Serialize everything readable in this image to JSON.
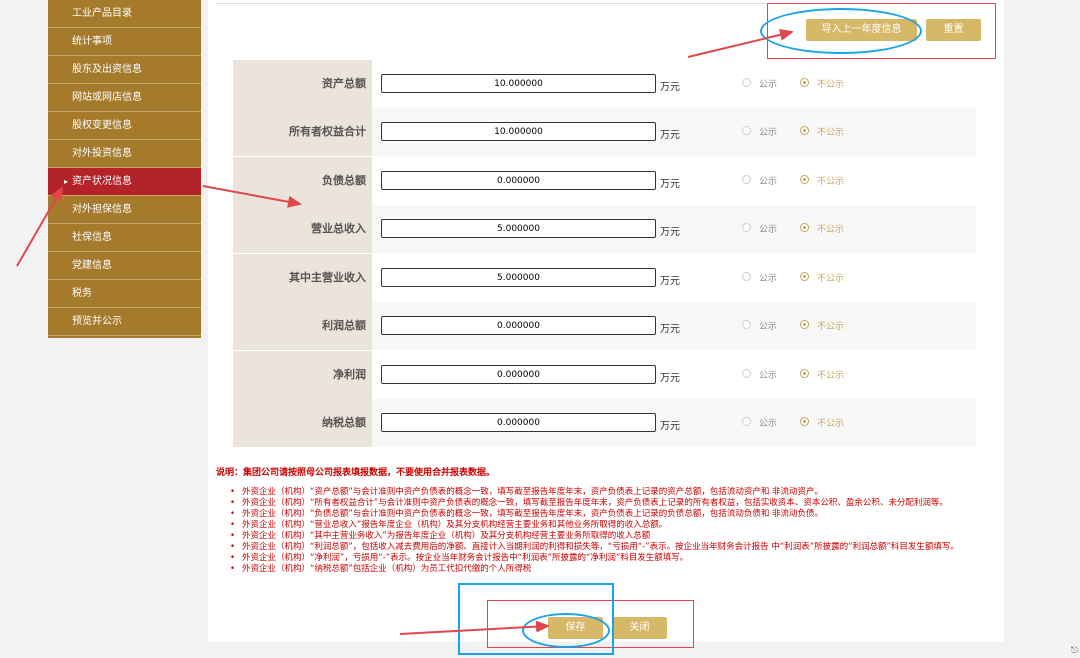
{
  "sidebar": {
    "items": [
      {
        "label": "工业产品目录"
      },
      {
        "label": "统计事项"
      },
      {
        "label": "股东及出资信息"
      },
      {
        "label": "网站或网店信息"
      },
      {
        "label": "股权变更信息"
      },
      {
        "label": "对外投资信息"
      },
      {
        "label": "资产状况信息",
        "active": true
      },
      {
        "label": "对外担保信息"
      },
      {
        "label": "社保信息"
      },
      {
        "label": "党建信息"
      },
      {
        "label": "税务"
      },
      {
        "label": "预览并公示"
      }
    ]
  },
  "toolbar": {
    "import_label": "导入上一年度信息",
    "reset_label": "重置"
  },
  "form": {
    "unit": "万元",
    "public_label": "公示",
    "private_label": "不公示",
    "rows": [
      {
        "label": "资产总额",
        "value": "10.000000"
      },
      {
        "label": "所有者权益合计",
        "value": "10.000000"
      },
      {
        "label": "负债总额",
        "value": "0.000000"
      },
      {
        "label": "营业总收入",
        "value": "5.000000"
      },
      {
        "label": "其中主营业收入",
        "value": "5.000000"
      },
      {
        "label": "利润总额",
        "value": "0.000000"
      },
      {
        "label": "净利润",
        "value": "0.000000"
      },
      {
        "label": "纳税总额",
        "value": "0.000000"
      }
    ]
  },
  "notes": {
    "title": "说明：集团公司请按照母公司报表填报数据，不要使用合并报表数据。",
    "items": [
      "外资企业（机构）“资产总额”与会计准则中资产负债表的概念一致，填写截至报告年度年末，资产负债表上记录的资产总额，包括流动资产和 非流动资产。",
      "外资企业（机构）“所有者权益合计”与会计准则中资产负债表的概念一致，填写截至报告年度年末，资产负债表上记录的所有者权益，包括实收资本、资本公积、盈余公积、未分配利润等。",
      "外资企业（机构）“负债总额”与会计准则中资产负债表的概念一致，填写截至报告年度年末，资产负债表上记录的负债总额，包括流动负债和 非流动负债。",
      "外资企业（机构）“营业总收入”报告年度企业（机构）及其分支机构经营主要业务和其他业务所取得的收入总额。",
      "外资企业（机构）“其中主营业务收入”为报告年度企业（机构）及其分支机构经营主要业务所取得的收入总额",
      "外资企业（机构）“利润总额”，包括收入减去费用后的净额、直接计入当期利润的利得和损失等，“亏损用“-”表示。按企业当年财务会计报告 中“利润表”所披露的“利润总额”科目发生额填写。",
      "外资企业（机构）“净利润”，亏损用“-”表示。按企业当年财务会计报告中“利润表”所披露的“净利润”科目发生额填写。",
      "外资企业（机构）“纳税总额”包括企业（机构）为员工代扣代缴的个人所得税"
    ]
  },
  "footer": {
    "save_label": "保存",
    "close_label": "关闭"
  },
  "colors": {
    "sidebar": "#a57a2b",
    "active": "#b5232a",
    "button": "#d7b768",
    "annotation_red": "#e0474c",
    "annotation_blue": "#1aa3e8"
  }
}
